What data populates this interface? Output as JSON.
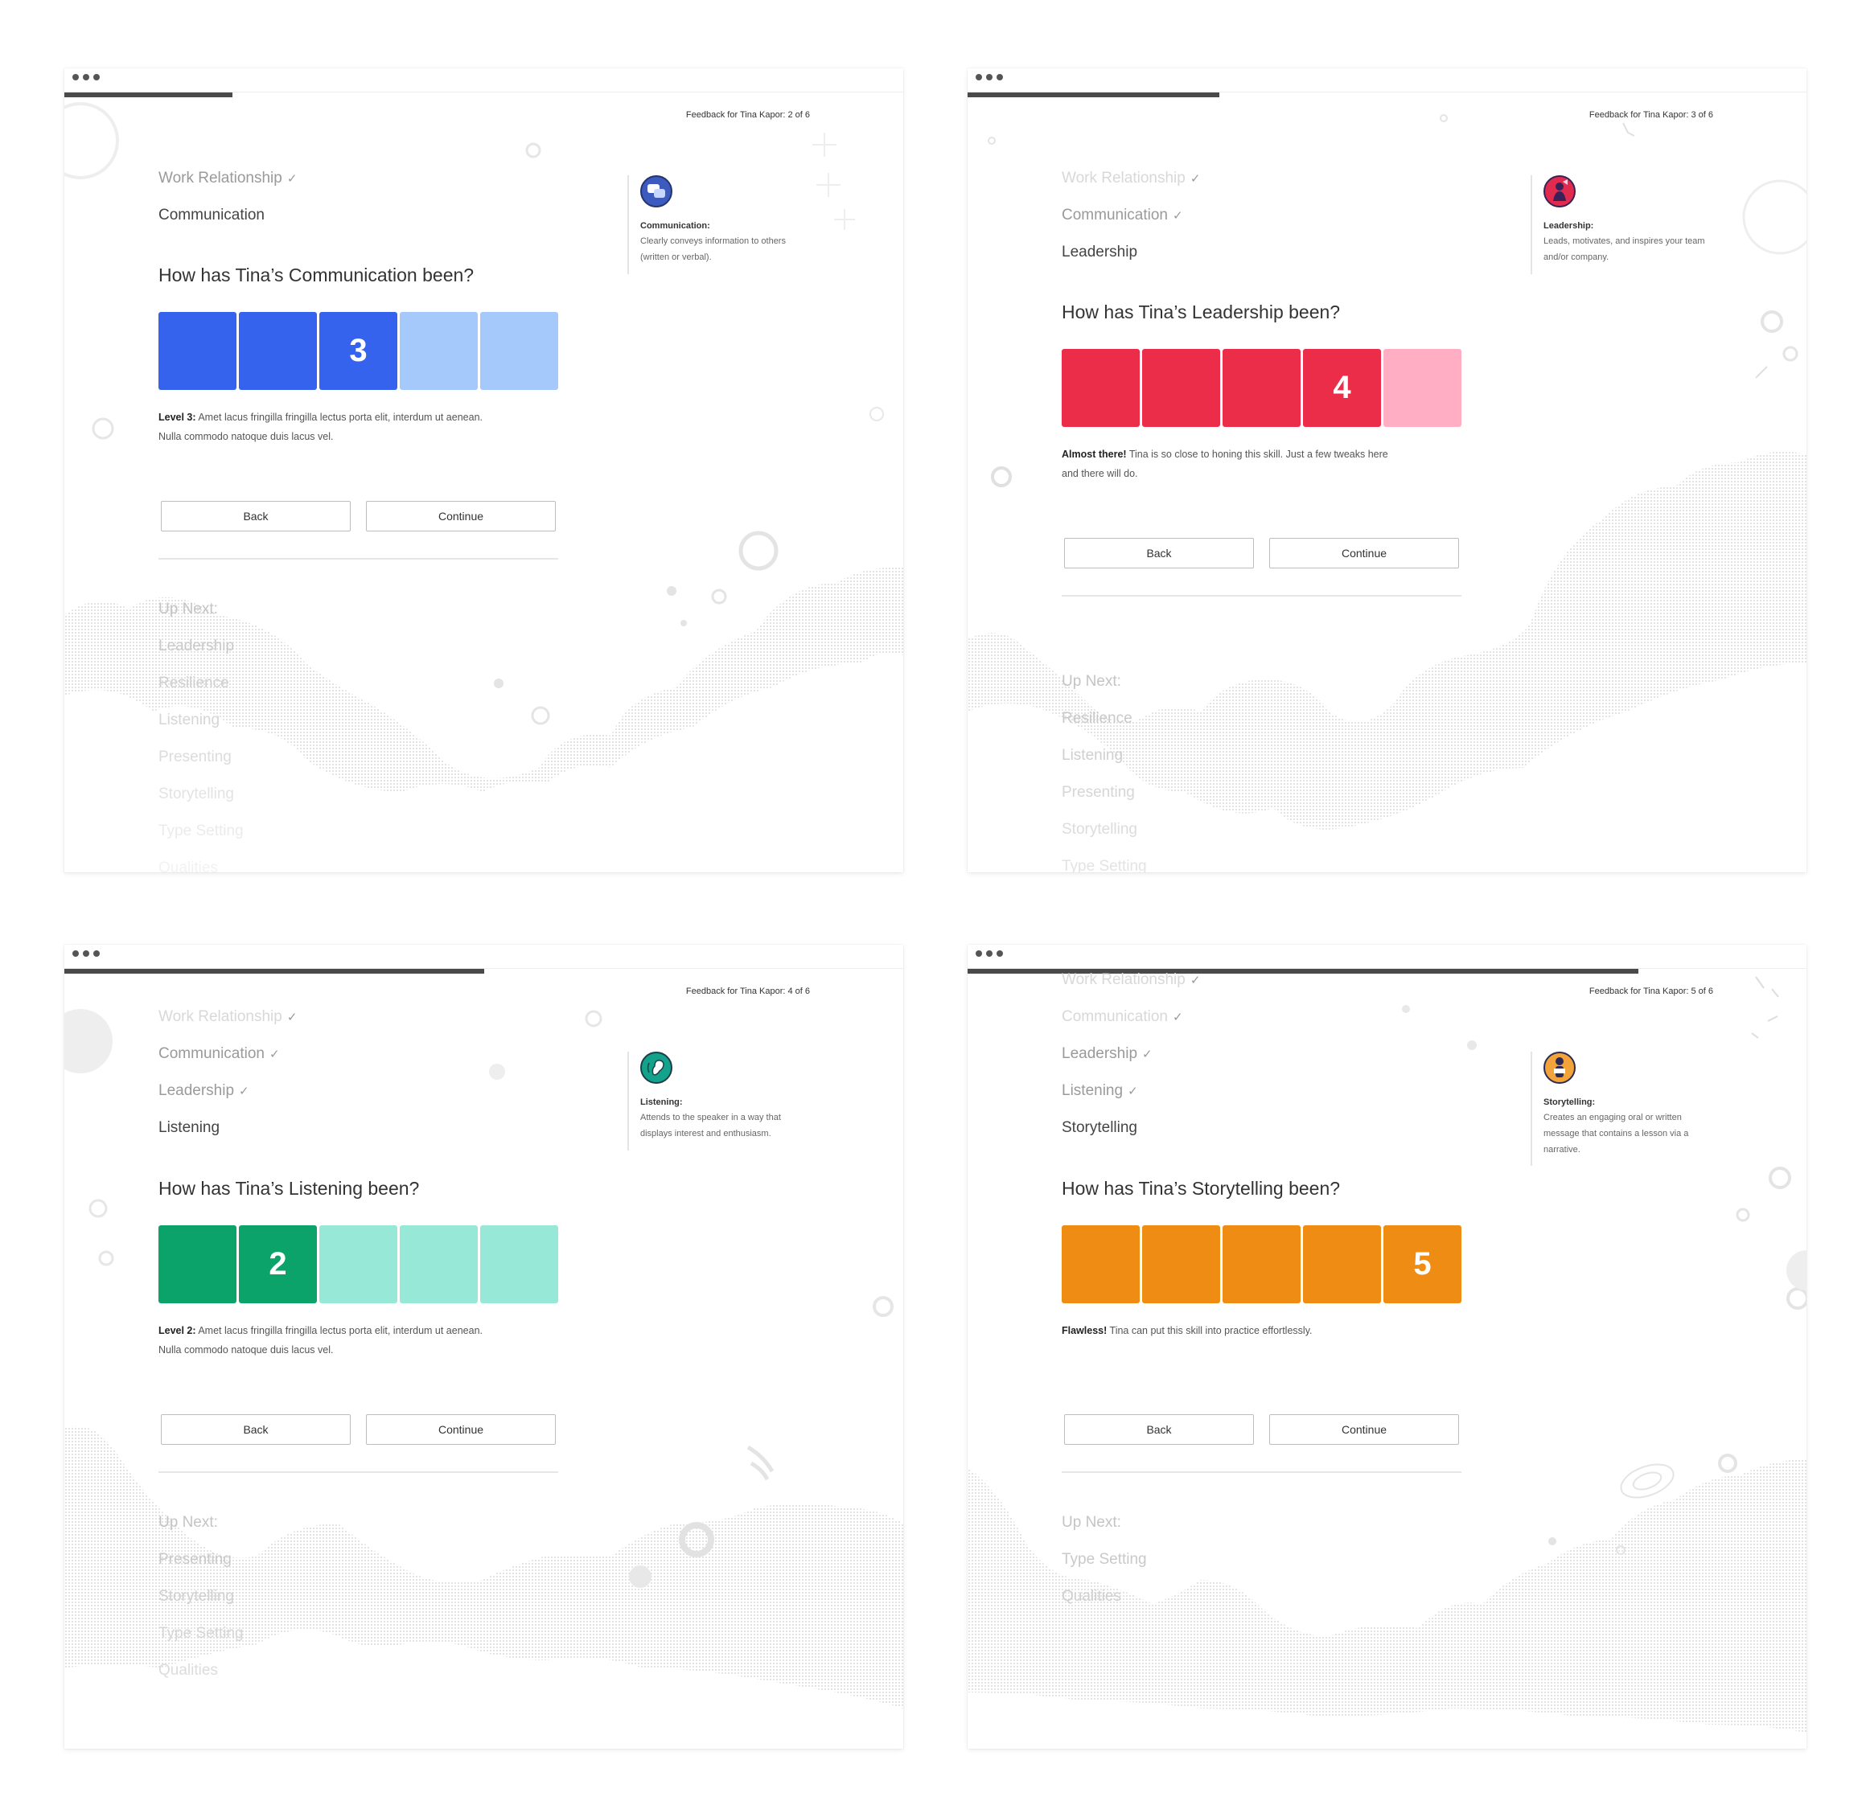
{
  "windows": [
    {
      "counter": "Feedback for Tina Kapor: 2 of 6",
      "progress": 0.2,
      "completed": [
        "Work Relationship"
      ],
      "current": "Communication",
      "question": "How has Tina’s Communication been?",
      "rating": {
        "value": 3,
        "value_label": "3",
        "active_color": "#3563ee",
        "inactive_color": "#a5c9fb"
      },
      "level_title": "Level 3:",
      "level_text": " Amet lacus fringilla fringilla lectus porta elit, interdum ut aenean. Nulla commodo natoque duis lacus vel.",
      "back_label": "Back",
      "continue_label": "Continue",
      "upnext_title": "Up Next:",
      "upnext": [
        "Leadership",
        "Resilience",
        "Listening",
        "Presenting",
        "Storytelling",
        "Type Setting",
        "Qualities"
      ],
      "skill": {
        "title": "Communication:",
        "desc": "Clearly conveys information to others (written or verbal).",
        "icon": "speech-bubbles-icon",
        "icon_color": "#3d5bbf"
      }
    },
    {
      "counter": "Feedback for Tina Kapor: 3 of 6",
      "progress": 0.3,
      "completed": [
        "Work Relationship",
        "Communication"
      ],
      "current": "Leadership",
      "question": "How has Tina’s Leadership been?",
      "rating": {
        "value": 4,
        "value_label": "4",
        "active_color": "#eb2d4a",
        "inactive_color": "#ffaec4"
      },
      "level_title": "Almost there!",
      "level_text": " Tina is so close to honing this skill. Just a few tweaks here and there will do.",
      "back_label": "Back",
      "continue_label": "Continue",
      "upnext_title": "Up Next:",
      "upnext": [
        "Resilience",
        "Listening",
        "Presenting",
        "Storytelling",
        "Type Setting"
      ],
      "skill": {
        "title": "Leadership:",
        "desc": "Leads, motivates, and inspires your team and/or company.",
        "icon": "leader-figure-icon",
        "icon_color": "#e02a4e"
      }
    },
    {
      "counter": "Feedback for Tina Kapor: 4 of 6",
      "progress": 0.5,
      "completed": [
        "Work Relationship",
        "Communication",
        "Leadership"
      ],
      "current": "Listening",
      "question": "How has Tina’s Listening been?",
      "rating": {
        "value": 2,
        "value_label": "2",
        "active_color": "#0ca36a",
        "inactive_color": "#98e8d8"
      },
      "level_title": "Level 2:",
      "level_text": " Amet lacus fringilla fringilla lectus porta elit, interdum ut aenean. Nulla commodo natoque duis lacus vel.",
      "back_label": "Back",
      "continue_label": "Continue",
      "upnext_title": "Up Next:",
      "upnext": [
        "Presenting",
        "Storytelling",
        "Type Setting",
        "Qualities"
      ],
      "skill": {
        "title": "Listening:",
        "desc": "Attends to the speaker in a way that displays interest and enthusiasm.",
        "icon": "ear-icon",
        "icon_color": "#12a38a"
      }
    },
    {
      "counter": "Feedback for Tina Kapor: 5 of 6",
      "progress": 0.8,
      "completed": [
        "Work Relationship",
        "Communication",
        "Leadership",
        "Listening"
      ],
      "current": "Storytelling",
      "question": "How has Tina’s Storytelling been?",
      "rating": {
        "value": 5,
        "value_label": "5",
        "active_color": "#ef8c13",
        "inactive_color": "#ffd28f"
      },
      "level_title": "Flawless!",
      "level_text": " Tina can put this skill into practice effortlessly.",
      "back_label": "Back",
      "continue_label": "Continue",
      "upnext_title": "Up Next:",
      "upnext": [
        "Type Setting",
        "Qualities"
      ],
      "skill": {
        "title": "Storytelling:",
        "desc": "Creates an engaging oral or written message that contains a lesson via a narrative.",
        "icon": "storyteller-icon",
        "icon_color": "#f2a33a"
      }
    }
  ]
}
